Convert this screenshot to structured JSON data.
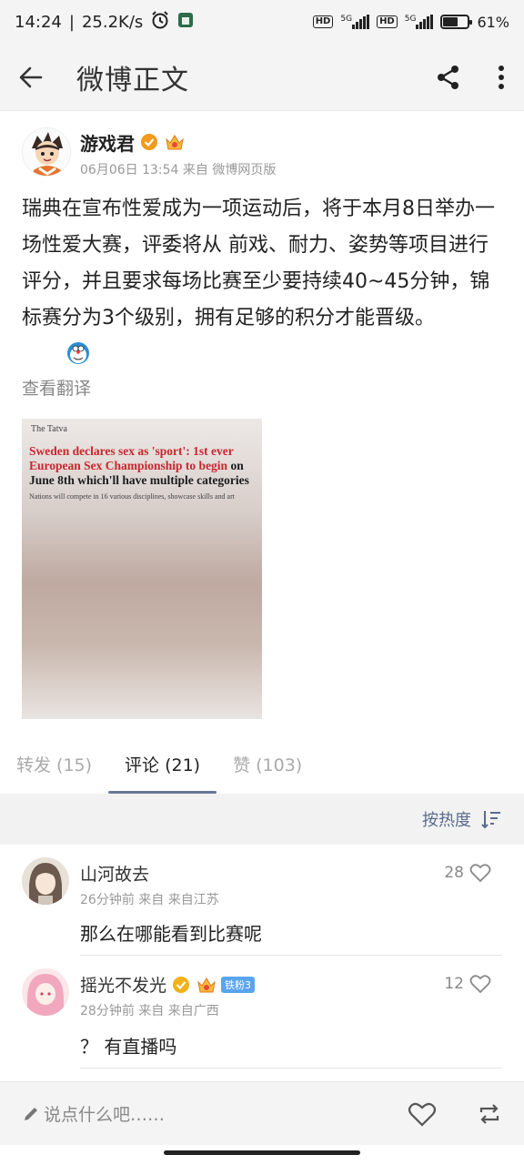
{
  "status_bar": {
    "time": "14:24",
    "speed": "25.2K/s",
    "hd1": "HD",
    "net1": "5G",
    "hd2": "HD",
    "net2": "5G",
    "battery_percent": "61%",
    "battery_level": 0.61
  },
  "header": {
    "title": "微博正文",
    "back_icon": "arrow-left-icon",
    "share_icon": "share-icon",
    "more_icon": "more-vertical-icon"
  },
  "post": {
    "author": "游戏君",
    "meta": "06月06日 13:54  来自 微博网页版",
    "text": "瑞典在宣布性爱成为一项运动后，将于本月8日举办一场性爱大赛，评委将从 前戏、耐力、姿势等项目进行评分，并且要求每场比赛至少要持续40~45分钟，锦标赛分为3个级别，拥有足够的积分才能晋级。",
    "translate": "查看翻译",
    "image": {
      "logo": "The Tatva",
      "headline_red": "Sweden declares sex as 'sport': 1st ever European Sex Championship to begin",
      "headline_dark_1": " on",
      "headline_dark_2": "June 8th which'll have multiple categories",
      "subhead": "Nations will compete in 16 various disciplines, showcase skills and art"
    }
  },
  "tabs": [
    {
      "label": "转发 (15)",
      "active": false
    },
    {
      "label": "评论 (21)",
      "active": true
    },
    {
      "label": "赞 (103)",
      "active": false
    }
  ],
  "sort": {
    "label": "按热度"
  },
  "comments": [
    {
      "name": "山河故去",
      "meta": "26分钟前  来自  来自江苏",
      "text": "那么在哪能看到比赛呢",
      "likes": "28"
    },
    {
      "name": "摇光不发光",
      "badge": "铁粉3",
      "meta": "28分钟前  来自  来自广西",
      "text": "？ 有直播吗",
      "likes": "12"
    }
  ],
  "bottom_bar": {
    "placeholder": "说点什么吧……"
  },
  "colors": {
    "accent": "#6a7596",
    "sort_text": "#5a6b8c",
    "badge_blue": "#5aa4f0",
    "verified_orange": "#f29a1a"
  }
}
